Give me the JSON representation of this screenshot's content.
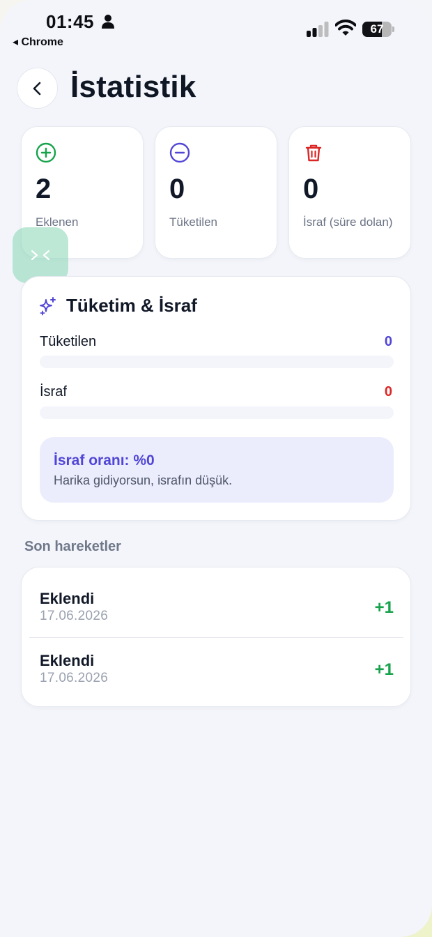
{
  "status_bar": {
    "time": "01:45",
    "back_app": "◂ Chrome",
    "battery": "67",
    "battery_level": 0.67
  },
  "header": {
    "title": "İstatistik"
  },
  "stats": [
    {
      "icon": "plus-circle-icon",
      "value": "2",
      "label": "Eklenen",
      "color": "#16a34a"
    },
    {
      "icon": "minus-circle-icon",
      "value": "0",
      "label": "Tüketilen",
      "color": "#5145d6"
    },
    {
      "icon": "trash-icon",
      "value": "0",
      "label": "İsraf (süre dolan)",
      "color": "#dc2626"
    }
  ],
  "consumption": {
    "title": "Tüketim & İsraf",
    "rows": [
      {
        "label": "Tüketilen",
        "value": "0",
        "color": "#5145d6",
        "fill": 0
      },
      {
        "label": "İsraf",
        "value": "0",
        "color": "#dc2626",
        "fill": 0
      }
    ],
    "ratio_title": "İsraf oranı: %0",
    "ratio_subtitle": "Harika gidiyorsun, israfın düşük."
  },
  "recent": {
    "heading": "Son hareketler",
    "items": [
      {
        "title": "Eklendi",
        "date": "17.06.2026",
        "qty": "+1"
      },
      {
        "title": "Eklendi",
        "date": "17.06.2026",
        "qty": "+1"
      }
    ]
  }
}
